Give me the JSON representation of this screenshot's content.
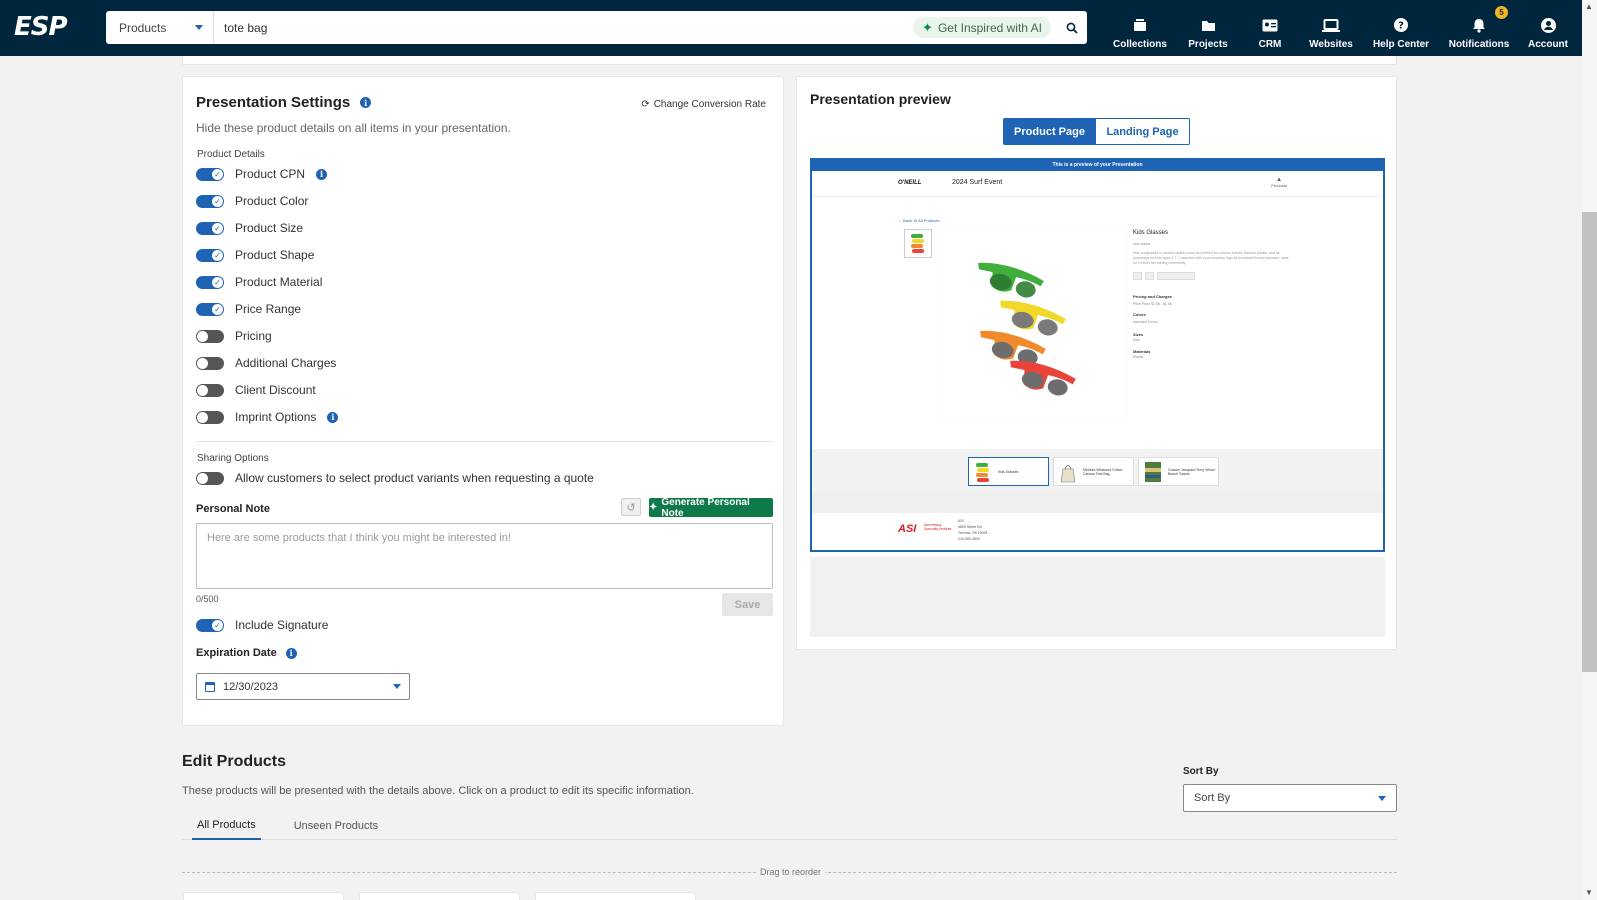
{
  "nav": {
    "logo": "ESP",
    "search_category": "Products",
    "search_value": "tote bag",
    "inspire_label": "Get Inspired with AI",
    "items": [
      {
        "label": "Collections",
        "icon": "collections-icon"
      },
      {
        "label": "Projects",
        "icon": "folder-icon"
      },
      {
        "label": "CRM",
        "icon": "contact-card-icon"
      },
      {
        "label": "Websites",
        "icon": "laptop-icon"
      },
      {
        "label": "Help Center",
        "icon": "help-icon"
      },
      {
        "label": "Notifications",
        "icon": "bell-icon",
        "badge": "5"
      },
      {
        "label": "Account",
        "icon": "account-icon"
      }
    ]
  },
  "settings": {
    "title": "Presentation Settings",
    "conversion_label": "Change Conversion Rate",
    "subtitle": "Hide these product details on all items in your presentation.",
    "product_details_label": "Product Details",
    "toggles": [
      {
        "label": "Product CPN",
        "on": true,
        "info": true
      },
      {
        "label": "Product Color",
        "on": true
      },
      {
        "label": "Product Size",
        "on": true
      },
      {
        "label": "Product Shape",
        "on": true
      },
      {
        "label": "Product Material",
        "on": true
      },
      {
        "label": "Price Range",
        "on": true
      },
      {
        "label": "Pricing",
        "on": false
      },
      {
        "label": "Additional Charges",
        "on": false
      },
      {
        "label": "Client Discount",
        "on": false
      },
      {
        "label": "Imprint Options",
        "on": false,
        "info": true
      }
    ],
    "sharing_label": "Sharing Options",
    "sharing_toggle": {
      "label": "Allow customers to select product variants when requesting a quote",
      "on": false
    },
    "personal_note_label": "Personal Note",
    "generate_label": "Generate Personal Note",
    "note_placeholder": "Here are some products that I think you might be interested in!",
    "note_counter": "0/500",
    "save_label": "Save",
    "signature_toggle": {
      "label": "Include Signature",
      "on": true
    },
    "expiration_label": "Expiration Date",
    "expiration_value": "12/30/2023"
  },
  "preview": {
    "title": "Presentation preview",
    "tab_product": "Product Page",
    "tab_landing": "Landing Page",
    "banner": "This is a preview of your Presentation",
    "brand": "O'NEILL",
    "event": "2024 Surf Event",
    "products_link": "Products",
    "back_link": "← Back To All Products",
    "product_name": "Kids Glasses",
    "cpn": "CPN-729843",
    "description": "Kids sunglasses in various stylish colors are perfect for outdoor events, themed parties, and as giveaways for kids aged 3-7. Customize with your company logo for increased brand exposure, ideal for O'neill's fun surfing community.",
    "pricing_label": "Pricing and Charges",
    "price_value": "Price From $1.08 - $1.46",
    "colors_label": "Colors",
    "colors_value": "Assorted Colors",
    "sizes_label": "Sizes",
    "sizes_value": "Kids",
    "materials_label": "Materials",
    "materials_value": "Plastic",
    "strip": [
      {
        "name": "Kids Glasses",
        "selected": true
      },
      {
        "name": "Medium Weekend Cotton Canvas Tote Bag",
        "selected": false
      },
      {
        "name": "Custom Jacquard Terry Velour Beach Towels",
        "selected": false
      }
    ],
    "footer_logo": "ASI",
    "footer_sub": "Advertising Specialty Institute",
    "footer_addr": [
      "ASI",
      "4800 Street Rd",
      "Trevose, PA 19053",
      "215-953-3800"
    ]
  },
  "edit": {
    "title": "Edit Products",
    "subtitle": "These products will be presented with the details above. Click on a product to edit its specific information.",
    "sort_label": "Sort By",
    "sort_value": "Sort By",
    "tabs": [
      "All Products",
      "Unseen Products"
    ],
    "drag_label": "Drag to reorder"
  },
  "colors": {
    "header": "#00263e",
    "accent": "#1e63b4",
    "green": "#0e7a4a"
  }
}
